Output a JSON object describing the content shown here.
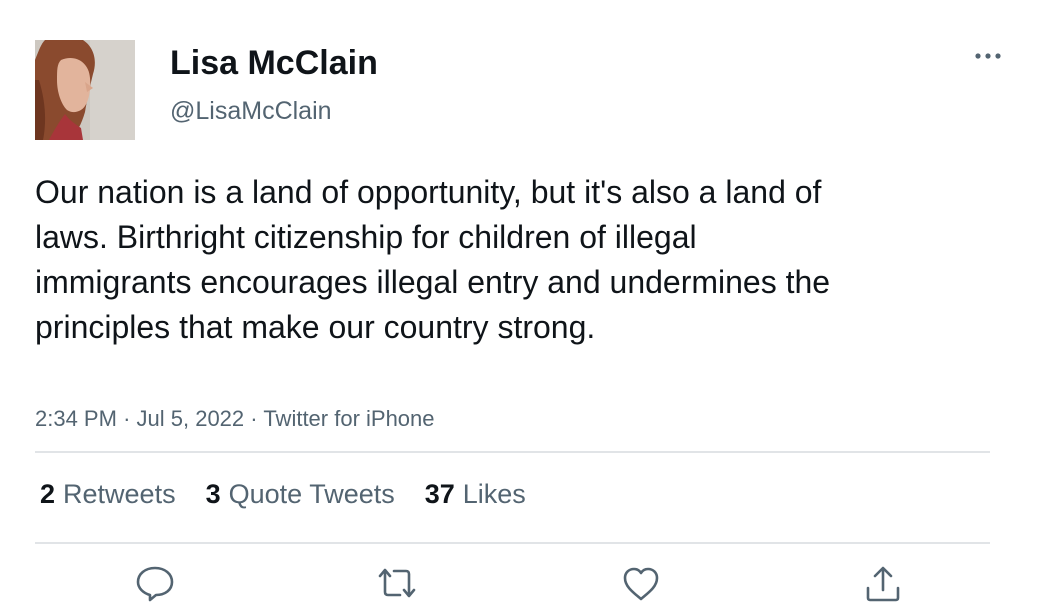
{
  "user": {
    "display_name": "Lisa McClain",
    "handle": "@LisaMcClain",
    "avatar_icon": "profile-photo"
  },
  "tweet": {
    "text": "Our nation is a land of opportunity, but it's also a land of laws. Birthright citizenship for children of illegal immigrants encourages illegal entry and undermines the principles that make our country strong.",
    "time": "2:34 PM",
    "separator": "·",
    "date": "Jul 5, 2022",
    "source": "Twitter for iPhone"
  },
  "stats": {
    "retweets_count": "2",
    "retweets_label": "Retweets",
    "quote_count": "3",
    "quote_label": "Quote Tweets",
    "likes_count": "37",
    "likes_label": "Likes"
  },
  "actions": {
    "reply_icon": "speech-bubble-icon",
    "retweet_icon": "retweet-arrows-icon",
    "like_icon": "heart-icon",
    "share_icon": "share-upload-icon",
    "more_icon": "ellipsis-icon"
  },
  "colors": {
    "text_primary": "#0f1419",
    "text_secondary": "#536471",
    "divider": "#e1e4e7"
  }
}
